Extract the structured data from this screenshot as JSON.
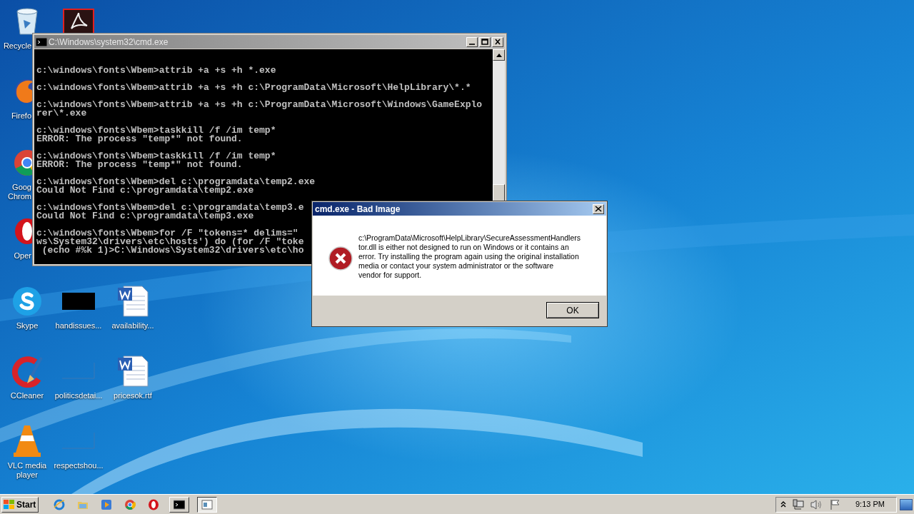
{
  "desktop_icons": [
    {
      "kind": "recycle",
      "label_lines": [
        "Recycle"
      ]
    },
    {
      "kind": "pdf"
    },
    {
      "kind": "firefox",
      "label_lines": [
        "Firefo"
      ]
    },
    {
      "kind": "chrome",
      "label_lines": [
        "Goog",
        "Chrom"
      ]
    },
    {
      "kind": "opera",
      "label_lines": [
        "Oper"
      ]
    },
    {
      "kind": "skype",
      "label_lines": [
        "Skype"
      ]
    },
    {
      "kind": "black",
      "label_lines": [
        "handissues..."
      ]
    },
    {
      "kind": "word",
      "label_lines": [
        "availability..."
      ]
    },
    {
      "kind": "ccleaner",
      "label_lines": [
        "CCleaner"
      ]
    },
    {
      "kind": "blank",
      "label_lines": [
        "politicsdetai..."
      ]
    },
    {
      "kind": "word",
      "label_lines": [
        "pricesok.rtf"
      ]
    },
    {
      "kind": "vlc",
      "label_lines": [
        "VLC media",
        "player"
      ]
    },
    {
      "kind": "blank",
      "label_lines": [
        "respectshou..."
      ]
    }
  ],
  "console_window": {
    "title": "C:\\Windows\\system32\\cmd.exe",
    "groups": [
      [
        "c:\\windows\\fonts\\Wbem>attrib +a +s +h *.exe"
      ],
      [
        "c:\\windows\\fonts\\Wbem>attrib +a +s +h c:\\ProgramData\\Microsoft\\HelpLibrary\\*.*"
      ],
      [
        "c:\\windows\\fonts\\Wbem>attrib +a +s +h c:\\ProgramData\\Microsoft\\Windows\\GameExplo",
        "rer\\*.exe"
      ],
      [
        "c:\\windows\\fonts\\Wbem>taskkill /f /im temp*",
        "ERROR: The process \"temp*\" not found."
      ],
      [
        "c:\\windows\\fonts\\Wbem>taskkill /f /im temp*",
        "ERROR: The process \"temp*\" not found."
      ],
      [
        "c:\\windows\\fonts\\Wbem>del c:\\programdata\\temp2.exe",
        "Could Not Find c:\\programdata\\temp2.exe"
      ],
      [
        "c:\\windows\\fonts\\Wbem>del c:\\programdata\\temp3.e",
        "Could Not Find c:\\programdata\\temp3.exe"
      ],
      [
        "c:\\windows\\fonts\\Wbem>for /F \"tokens=* delims=\" ",
        "ws\\System32\\drivers\\etc\\hosts') do (for /F \"toke",
        " (echo #%k 1)>C:\\Windows\\System32\\drivers\\etc\\ho"
      ]
    ]
  },
  "dialog": {
    "title": "cmd.exe - Bad Image",
    "message_lines": [
      "c:\\ProgramData\\Microsoft\\HelpLibrary\\SecureAssessmentHandlers",
      "tor.dll is either not designed to run on Windows or it contains an",
      "error. Try installing the program again using the original installation",
      "media or contact your system administrator or the software",
      "vendor for support."
    ],
    "button": "OK"
  },
  "taskbar": {
    "start": "Start",
    "items": [
      {
        "kind": "ie",
        "selected": false
      },
      {
        "kind": "explorer",
        "selected": false
      },
      {
        "kind": "media",
        "selected": false
      },
      {
        "kind": "chrome",
        "selected": false
      },
      {
        "kind": "opera",
        "selected": false
      },
      {
        "kind": "cmd",
        "selected": false
      },
      {
        "kind": "window",
        "selected": true
      }
    ],
    "clock": "9:13 PM"
  }
}
